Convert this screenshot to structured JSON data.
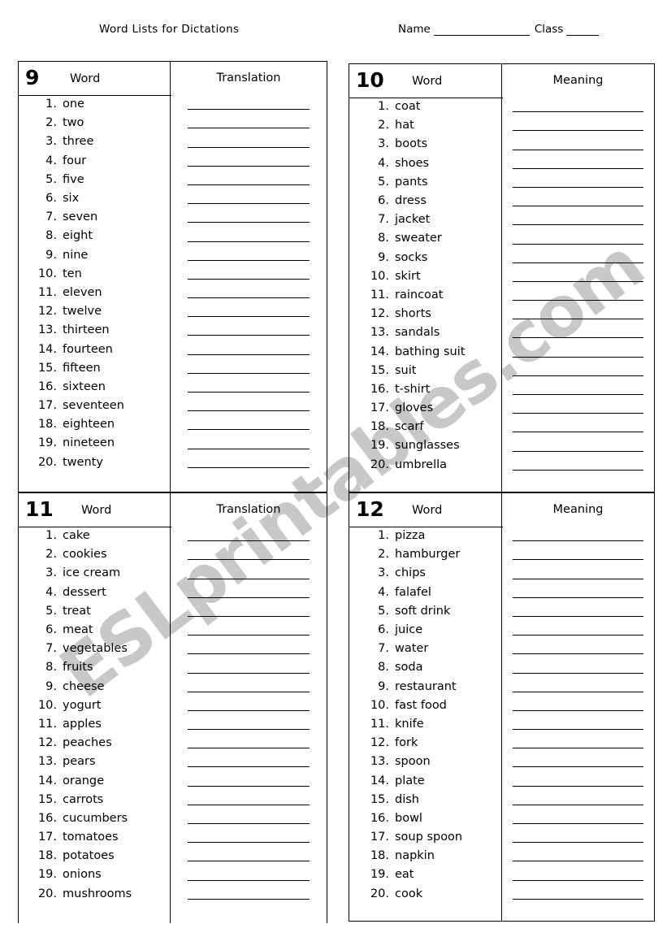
{
  "header": {
    "doc_title": "Word Lists for Dictations",
    "name_label": "Name",
    "class_label": "Class"
  },
  "watermark": {
    "text": "ESLprintables.com"
  },
  "tables": [
    {
      "number": "9",
      "word_header": "Word",
      "answer_header": "Translation",
      "items": [
        {
          "n": "1.",
          "w": "one"
        },
        {
          "n": "2.",
          "w": "two"
        },
        {
          "n": "3.",
          "w": "three"
        },
        {
          "n": "4.",
          "w": "four"
        },
        {
          "n": "5.",
          "w": "five"
        },
        {
          "n": "6.",
          "w": "six"
        },
        {
          "n": "7.",
          "w": "seven"
        },
        {
          "n": "8.",
          "w": "eight"
        },
        {
          "n": "9.",
          "w": "nine"
        },
        {
          "n": "10.",
          "w": "ten"
        },
        {
          "n": "11.",
          "w": "eleven"
        },
        {
          "n": "12.",
          "w": "twelve"
        },
        {
          "n": "13.",
          "w": "thirteen"
        },
        {
          "n": "14.",
          "w": "fourteen"
        },
        {
          "n": "15.",
          "w": "fifteen"
        },
        {
          "n": "16.",
          "w": "sixteen"
        },
        {
          "n": "17.",
          "w": "seventeen"
        },
        {
          "n": "18.",
          "w": "eighteen"
        },
        {
          "n": "19.",
          "w": "nineteen"
        },
        {
          "n": "20.",
          "w": "twenty"
        }
      ]
    },
    {
      "number": "10",
      "word_header": "Word",
      "answer_header": "Meaning",
      "items": [
        {
          "n": "1.",
          "w": "coat"
        },
        {
          "n": "2.",
          "w": "hat"
        },
        {
          "n": "3.",
          "w": "boots"
        },
        {
          "n": "4.",
          "w": "shoes"
        },
        {
          "n": "5.",
          "w": "pants"
        },
        {
          "n": "6.",
          "w": "dress"
        },
        {
          "n": "7.",
          "w": "jacket"
        },
        {
          "n": "8.",
          "w": "sweater"
        },
        {
          "n": "9.",
          "w": "socks"
        },
        {
          "n": "10.",
          "w": "skirt"
        },
        {
          "n": "11.",
          "w": "raincoat"
        },
        {
          "n": "12.",
          "w": "shorts"
        },
        {
          "n": "13.",
          "w": "sandals"
        },
        {
          "n": "14.",
          "w": "bathing suit"
        },
        {
          "n": "15.",
          "w": "suit"
        },
        {
          "n": "16.",
          "w": "t-shirt"
        },
        {
          "n": "17.",
          "w": "gloves"
        },
        {
          "n": "18.",
          "w": "scarf"
        },
        {
          "n": "19.",
          "w": "sunglasses"
        },
        {
          "n": "20.",
          "w": "umbrella"
        }
      ]
    },
    {
      "number": "11",
      "word_header": "Word",
      "answer_header": "Translation",
      "items": [
        {
          "n": "1.",
          "w": "cake"
        },
        {
          "n": "2.",
          "w": "cookies"
        },
        {
          "n": "3.",
          "w": "ice cream"
        },
        {
          "n": "4.",
          "w": "dessert"
        },
        {
          "n": "5.",
          "w": "treat"
        },
        {
          "n": "6.",
          "w": "meat"
        },
        {
          "n": "7.",
          "w": "vegetables"
        },
        {
          "n": "8.",
          "w": "fruits"
        },
        {
          "n": "9.",
          "w": "cheese"
        },
        {
          "n": "10.",
          "w": "yogurt"
        },
        {
          "n": "11.",
          "w": "apples"
        },
        {
          "n": "12.",
          "w": "peaches"
        },
        {
          "n": "13.",
          "w": "pears"
        },
        {
          "n": "14.",
          "w": "orange"
        },
        {
          "n": "15.",
          "w": "carrots"
        },
        {
          "n": "16.",
          "w": "cucumbers"
        },
        {
          "n": "17.",
          "w": "tomatoes"
        },
        {
          "n": "18.",
          "w": "potatoes"
        },
        {
          "n": "19.",
          "w": "onions"
        },
        {
          "n": "20.",
          "w": "mushrooms"
        }
      ]
    },
    {
      "number": "12",
      "word_header": "Word",
      "answer_header": "Meaning",
      "items": [
        {
          "n": "1.",
          "w": "pizza"
        },
        {
          "n": "2.",
          "w": "hamburger"
        },
        {
          "n": "3.",
          "w": "chips"
        },
        {
          "n": "4.",
          "w": "falafel"
        },
        {
          "n": "5.",
          "w": "soft drink"
        },
        {
          "n": "6.",
          "w": "juice"
        },
        {
          "n": "7.",
          "w": "water"
        },
        {
          "n": "8.",
          "w": "soda"
        },
        {
          "n": "9.",
          "w": "restaurant"
        },
        {
          "n": "10.",
          "w": "fast food"
        },
        {
          "n": "11.",
          "w": "knife"
        },
        {
          "n": "12.",
          "w": "fork"
        },
        {
          "n": "13.",
          "w": "spoon"
        },
        {
          "n": "14.",
          "w": "plate"
        },
        {
          "n": "15.",
          "w": "dish"
        },
        {
          "n": "16.",
          "w": "bowl"
        },
        {
          "n": "17.",
          "w": "soup spoon"
        },
        {
          "n": "18.",
          "w": "napkin"
        },
        {
          "n": "19.",
          "w": "eat"
        },
        {
          "n": "20.",
          "w": "cook"
        }
      ]
    }
  ]
}
